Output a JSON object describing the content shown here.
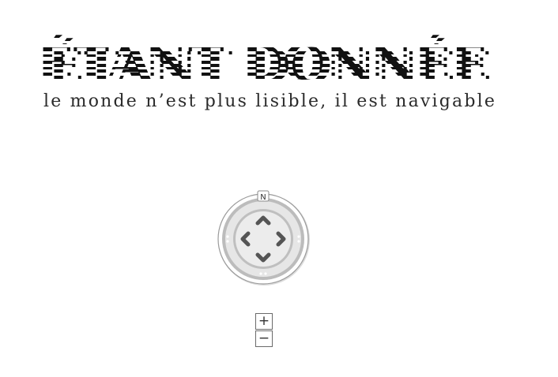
{
  "header": {
    "title": "ÉTANT DONNÉE",
    "subtitle": "le monde n’est plus lisible, il est navigable"
  },
  "compass": {
    "north_label": "N",
    "ring_color": "#b9b9b9",
    "arrow_color": "#555555"
  },
  "zoom": {
    "in_label": "+",
    "out_label": "−"
  }
}
